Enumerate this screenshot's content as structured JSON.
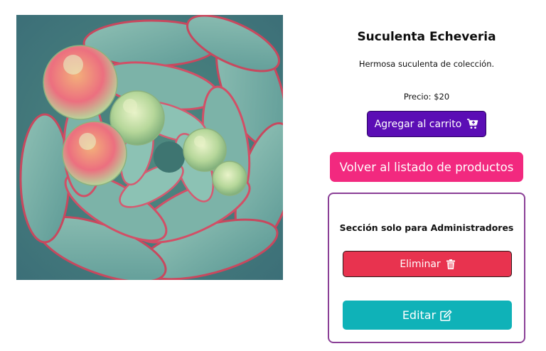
{
  "product": {
    "image_alt": "Suculenta Echeveria",
    "name": "Suculenta Echeveria",
    "description": "Hermosa suculenta de colección.",
    "price_text": "Precio: $20"
  },
  "actions": {
    "add_to_cart_label": "Agregar al carrito",
    "add_to_cart_icon": "cart-plus-icon",
    "back_label": "Volver al listado de productos"
  },
  "admin": {
    "section_title": "Sección solo para Administradores",
    "delete_label": "Eliminar",
    "delete_icon": "trash-icon",
    "edit_label": "Editar",
    "edit_icon": "edit-icon"
  },
  "colors": {
    "cart_button": "#5b0db5",
    "back_button": "#f2297f",
    "admin_border": "#8a3f96",
    "delete_button": "#e8334f",
    "edit_button": "#0fb2b8"
  }
}
